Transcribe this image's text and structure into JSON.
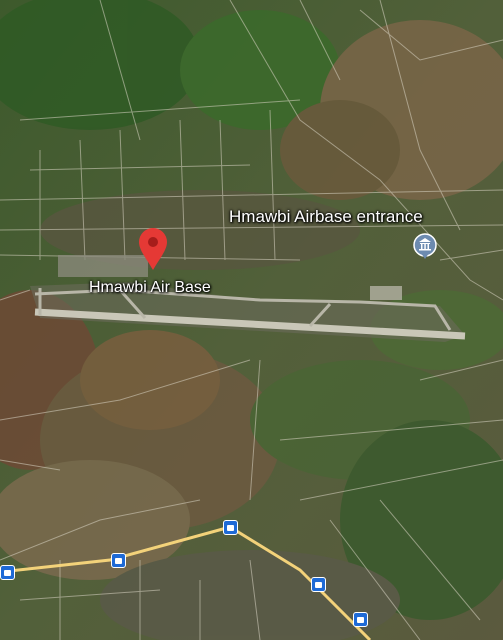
{
  "map": {
    "labels": {
      "air_base": "Hmawbi Air Base",
      "entrance": "Hmawbi Airbase entrance"
    },
    "markers": {
      "air_base_pin": "red-location-pin",
      "entrance_poi": "museum-landmark-icon",
      "transit": "bus-stop-icon"
    },
    "colors": {
      "pin": "#e53935",
      "poi": "#6d8bb0",
      "bus": "#1e6ad6",
      "transit_route": "#f3d27a",
      "roads": "#d9d4c4"
    }
  }
}
